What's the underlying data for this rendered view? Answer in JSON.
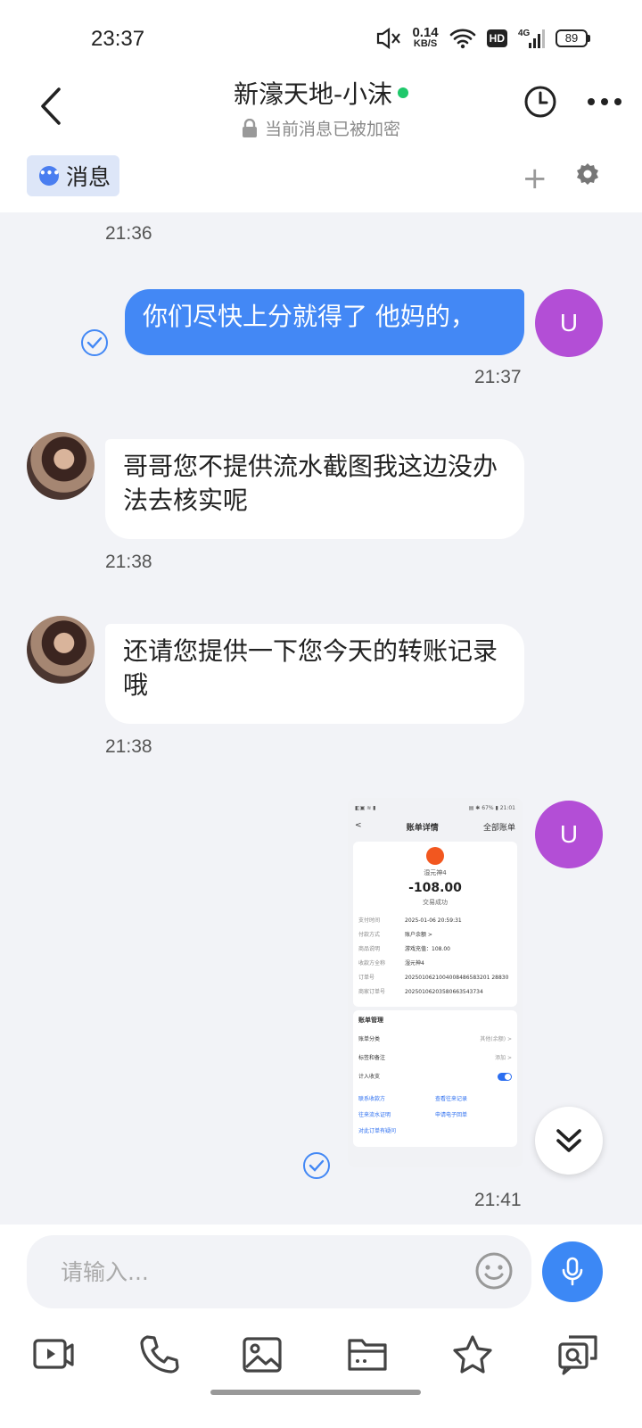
{
  "status_bar": {
    "time": "23:37",
    "net_speed": "0.14",
    "net_unit": "KB/S",
    "hd": "HD",
    "signal": "4G",
    "battery": "89"
  },
  "header": {
    "title": "新濠天地-小沫",
    "subtitle": "当前消息已被加密"
  },
  "tabs": [
    {
      "label": "消息",
      "icon": "chat-bubble-icon",
      "active": true
    }
  ],
  "messages": [
    {
      "type": "timestamp",
      "text": "21:36"
    },
    {
      "type": "outgoing",
      "text": "你们尽快上分就得了 他妈的，",
      "avatar": "U",
      "time": "21:37",
      "read": true
    },
    {
      "type": "incoming",
      "text": "哥哥您不提供流水截图我这边没办法去核实呢",
      "time": "21:38"
    },
    {
      "type": "incoming",
      "text": "还请您提供一下您今天的转账记录哦",
      "time": "21:38"
    },
    {
      "type": "outgoing-image",
      "avatar": "U",
      "time": "21:41",
      "read": true
    }
  ],
  "screenshot": {
    "status_left": "◧▣ ≋ ▮",
    "status_right": "▤ ✱ 67% ▮ 21:01",
    "back": "<",
    "title": "账单详情",
    "action": "全部账单",
    "merchant": "湿元神4",
    "amount": "-108.00",
    "result": "交易成功",
    "rows": [
      {
        "k": "支付时间",
        "v": "2025-01-06 20:59:31"
      },
      {
        "k": "付款方式",
        "v": "账户余额 >"
      },
      {
        "k": "商品说明",
        "v": "游戏充值：108.00"
      },
      {
        "k": "收款方全称",
        "v": "湿元神4"
      },
      {
        "k": "订单号",
        "v": "2025010621004008486583201 28830"
      },
      {
        "k": "商家订单号",
        "v": "20250106203580663543734"
      }
    ],
    "section": "账单管理",
    "manage": [
      {
        "k": "账单分类",
        "v": "其他(余额) >"
      },
      {
        "k": "标签和备注",
        "v": "添加 >"
      },
      {
        "k": "计入收支",
        "v": ""
      }
    ],
    "links": [
      "联系收款方",
      "查看往来记录",
      "往来流水证明",
      "申请电子回单",
      "对此订单有疑问"
    ]
  },
  "input": {
    "placeholder": "请输入..."
  },
  "toolbar": [
    "video-call-icon",
    "phone-icon",
    "image-icon",
    "folder-icon",
    "star-icon",
    "search-chat-icon"
  ],
  "colors": {
    "outgoing_bubble": "#4388f5",
    "avatar_u": "#b34ed6",
    "online": "#1fc86b",
    "background": "#f2f3f7"
  }
}
